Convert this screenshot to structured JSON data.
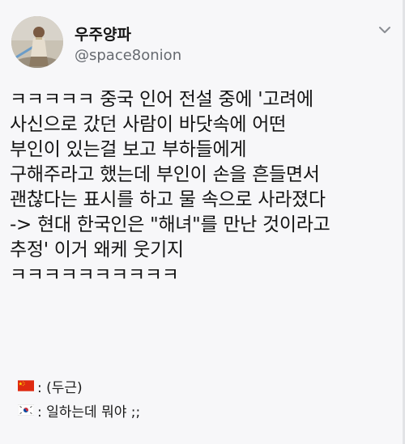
{
  "user": {
    "display_name": "우주양파",
    "handle": "@space8onion",
    "avatar_icon": "avatar-character-icon"
  },
  "header": {
    "menu_icon": "chevron-down-icon"
  },
  "tweet": {
    "lines": [
      "ㅋㅋㅋㅋㅋ 중국 인어 전설 중에 '고려에",
      "사신으로 갔던 사람이 바닷속에 어떤",
      "부인이 있는걸 보고 부하들에게",
      "구해주라고 했는데 부인이 손을 흔들면서",
      "괜찮다는 표시를 하고 물 속으로 사라졌다",
      "-> 현대 한국인은 \"해녀\"를 만난 것이라고",
      "추정' 이거 왜케 웃기지",
      "ㅋㅋㅋㅋㅋㅋㅋㅋㅋㅋ"
    ]
  },
  "reactions": [
    {
      "flag_icon": "china-flag-icon",
      "text": ": (두근)"
    },
    {
      "flag_icon": "south-korea-flag-icon",
      "text": ": 일하는데 뭐야 ;;"
    }
  ],
  "colors": {
    "background": "#f7f7f9",
    "text": "#141414",
    "handle": "#666a70",
    "china_red": "#de2910",
    "china_yellow": "#ffde00",
    "korea_red": "#cd2e3a",
    "korea_blue": "#0047a0"
  }
}
